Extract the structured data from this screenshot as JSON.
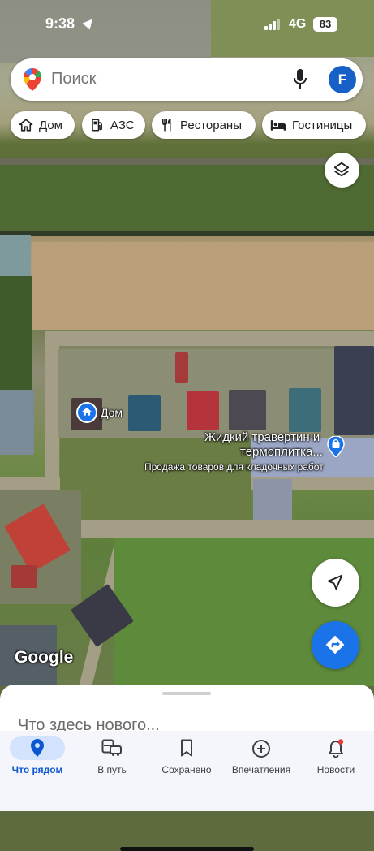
{
  "status_bar": {
    "time": "9:38",
    "network": "4G",
    "battery": "83"
  },
  "search": {
    "placeholder": "Поиск",
    "avatar_letter": "F"
  },
  "chips": [
    {
      "label": "Дом",
      "icon": "home-icon"
    },
    {
      "label": "АЗС",
      "icon": "gas-station-icon"
    },
    {
      "label": "Рестораны",
      "icon": "restaurant-icon"
    },
    {
      "label": "Гостиницы",
      "icon": "hotel-icon"
    }
  ],
  "map": {
    "home_label": "Дом",
    "place_name_line1": "Жидкий травертин и",
    "place_name_line2": "термоплитка...",
    "place_category": "Продажа товаров для кладочных работ",
    "logo": "Google"
  },
  "sheet": {
    "title": "Что здесь нового..."
  },
  "bottom_nav": [
    {
      "label": "Что рядом",
      "icon": "explore-pin-icon",
      "active": true
    },
    {
      "label": "В путь",
      "icon": "commute-icon",
      "active": false
    },
    {
      "label": "Сохранено",
      "icon": "bookmark-icon",
      "active": false
    },
    {
      "label": "Впечатления",
      "icon": "contribute-icon",
      "active": false
    },
    {
      "label": "Новости",
      "icon": "bell-icon",
      "active": false
    }
  ],
  "colors": {
    "accent": "#1a73e8",
    "active_pill": "#d3e3fd",
    "notification_dot": "#e33b2e"
  }
}
